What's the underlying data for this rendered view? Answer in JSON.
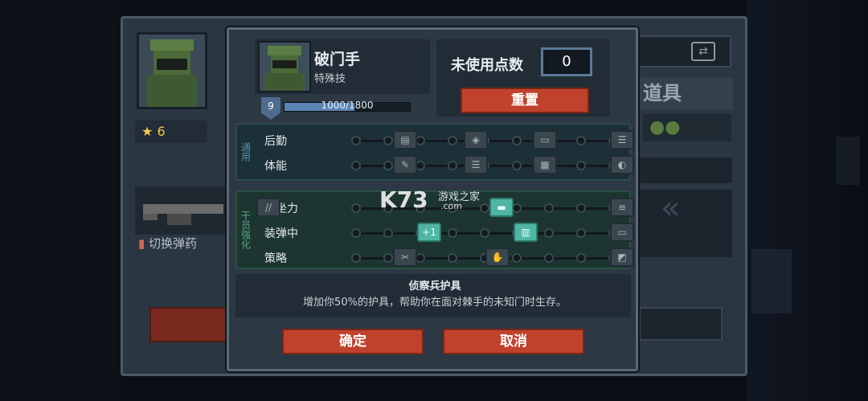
{
  "left_panel": {
    "star_count": "6",
    "switch_ammo": "切换弹药"
  },
  "right_panel": {
    "items_title": "道具"
  },
  "modal": {
    "hero": {
      "name": "破门手",
      "class": "特殊技",
      "level": "9",
      "xp_text": "1000/1800",
      "xp_progress": 0.556
    },
    "points": {
      "label": "未使用点数",
      "value": "0"
    },
    "reset_label": "重置",
    "section_general": {
      "title": "通用",
      "rows": [
        {
          "label": "后勤",
          "nodes": [
            "▤",
            "◈",
            "▭",
            "☰"
          ]
        },
        {
          "label": "体能",
          "nodes": [
            "✎",
            "☰",
            "▦",
            "◐"
          ]
        }
      ]
    },
    "section_weapon": {
      "title": "干员强化",
      "rows": [
        {
          "label": "后坐力",
          "nodes": [
            "▬",
            "≡",
            "//"
          ]
        },
        {
          "label": "装弹中",
          "nodes": [
            "+1",
            "▥",
            "▭"
          ]
        },
        {
          "label": "策略",
          "nodes": [
            "✂",
            "✋",
            "◩"
          ]
        }
      ]
    },
    "perk": {
      "title": "侦察兵护具",
      "description": "增加你50%的护具，帮助你在面对棘手的未知门时生存。"
    },
    "confirm_label": "确定",
    "cancel_label": "取消"
  },
  "watermark": {
    "logo": "K73",
    "site_cn": "游戏之家",
    "site_en": ".com"
  }
}
